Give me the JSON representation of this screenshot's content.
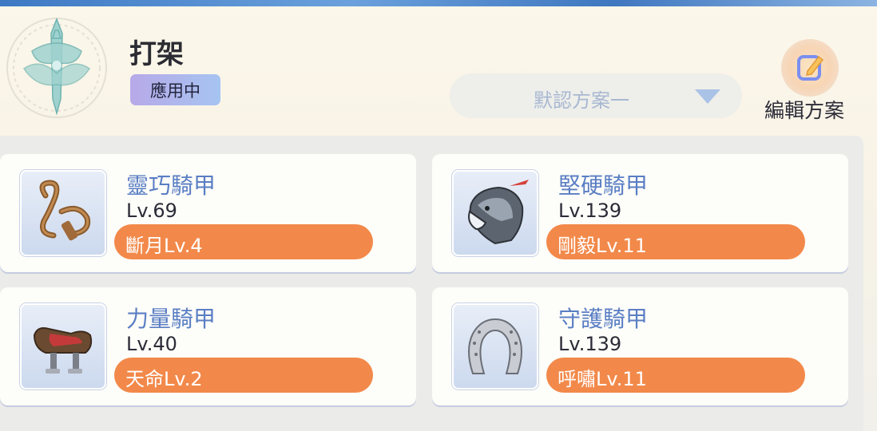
{
  "header": {
    "set_name": "打架",
    "status_badge": "應用中",
    "scheme_dropdown": "默認方案一",
    "edit_label": "編輯方案"
  },
  "armors": [
    {
      "name": "靈巧騎甲",
      "level": "Lv.69",
      "skill": "斷月Lv.4",
      "icon": "reins-icon"
    },
    {
      "name": "堅硬騎甲",
      "level": "Lv.139",
      "skill": "剛毅Lv.11",
      "icon": "horse-helmet-icon"
    },
    {
      "name": "力量騎甲",
      "level": "Lv.40",
      "skill": "天命Lv.2",
      "icon": "saddle-icon"
    },
    {
      "name": "守護騎甲",
      "level": "Lv.139",
      "skill": "呼嘯Lv.11",
      "icon": "horseshoe-icon"
    }
  ],
  "colors": {
    "accent_orange": "#f2894a",
    "name_blue": "#5a7ec4",
    "badge_gradient_start": "#b7a9e8",
    "badge_gradient_end": "#a6c4f1"
  }
}
